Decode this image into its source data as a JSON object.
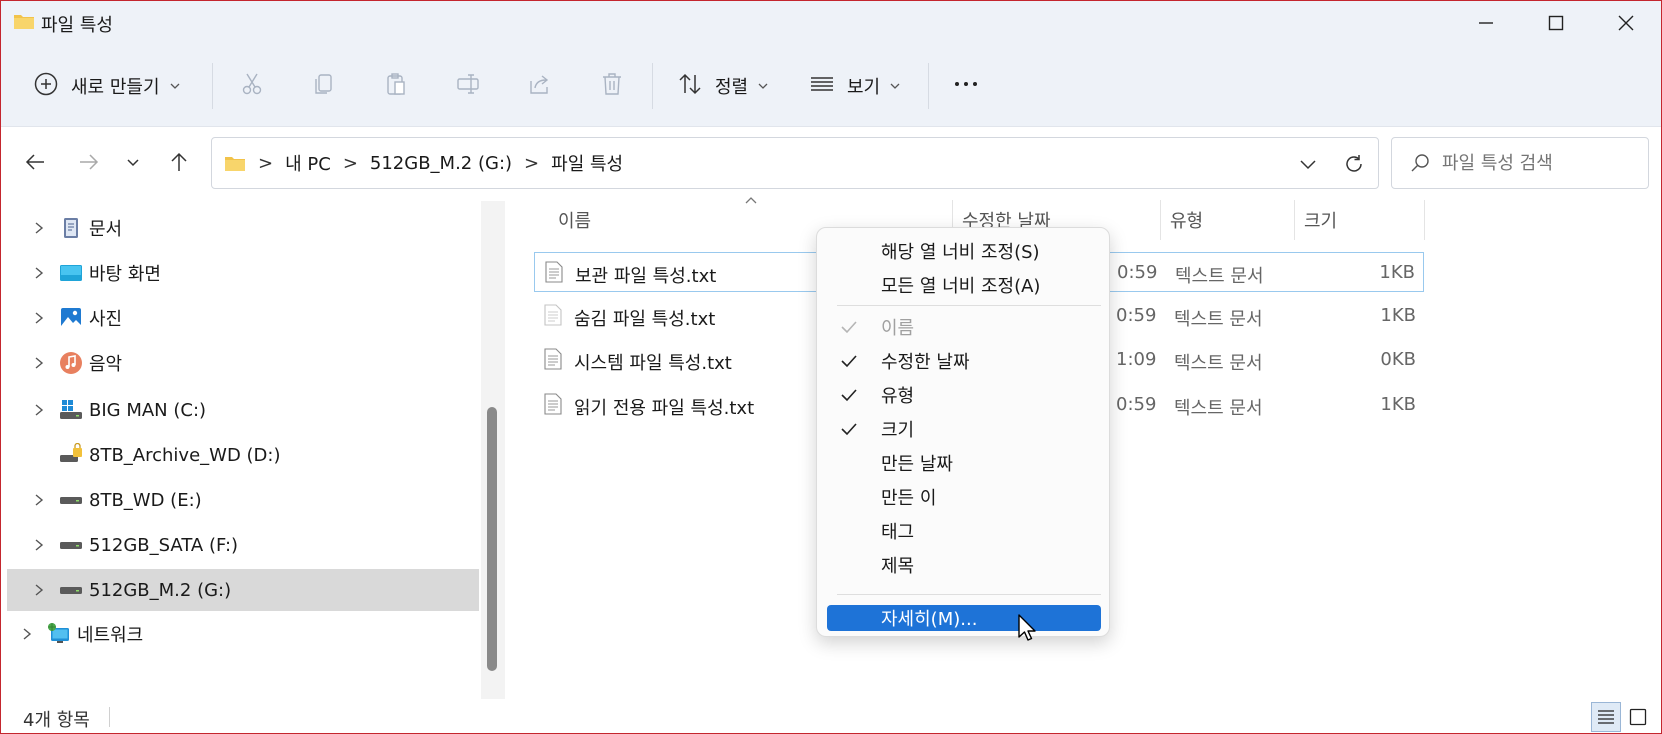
{
  "window": {
    "title": "파일 특성"
  },
  "toolbar": {
    "new_label": "새로 만들기",
    "sort_label": "정렬",
    "view_label": "보기"
  },
  "address": {
    "crumbs": [
      "내 PC",
      "512GB_M.2 (G:)",
      "파일 특성"
    ]
  },
  "search": {
    "placeholder": "파일 특성 검색"
  },
  "sidebar": {
    "items": [
      {
        "label": "문서",
        "icon": "documents-icon"
      },
      {
        "label": "바탕 화면",
        "icon": "desktop-icon"
      },
      {
        "label": "사진",
        "icon": "pictures-icon"
      },
      {
        "label": "음악",
        "icon": "music-icon"
      },
      {
        "label": "BIG MAN (C:)",
        "icon": "windows-drive-icon"
      },
      {
        "label": "8TB_Archive_WD (D:)",
        "icon": "locked-drive-icon"
      },
      {
        "label": "8TB_WD (E:)",
        "icon": "drive-icon"
      },
      {
        "label": "512GB_SATA (F:)",
        "icon": "drive-icon"
      },
      {
        "label": "512GB_M.2 (G:)",
        "icon": "drive-icon"
      },
      {
        "label": "네트워크",
        "icon": "network-icon"
      }
    ]
  },
  "columns": {
    "name": "이름",
    "date": "수정한 날짜",
    "type": "유형",
    "size": "크기"
  },
  "files": [
    {
      "name": "보관 파일 특성.txt",
      "date": "0:59",
      "type": "텍스트 문서",
      "size": "1KB"
    },
    {
      "name": "숨김 파일 특성.txt",
      "date": "0:59",
      "type": "텍스트 문서",
      "size": "1KB"
    },
    {
      "name": "시스템 파일 특성.txt",
      "date": "1:09",
      "type": "텍스트 문서",
      "size": "0KB"
    },
    {
      "name": "읽기 전용 파일 특성.txt",
      "date": "0:59",
      "type": "텍스트 문서",
      "size": "1KB"
    }
  ],
  "context_menu": {
    "fit_column": "해당 열 너비 조정(S)",
    "fit_all": "모든 열 너비 조정(A)",
    "items": [
      {
        "label": "이름",
        "checked": true,
        "disabled": true
      },
      {
        "label": "수정한 날짜",
        "checked": true
      },
      {
        "label": "유형",
        "checked": true
      },
      {
        "label": "크기",
        "checked": true
      },
      {
        "label": "만든 날짜",
        "checked": false
      },
      {
        "label": "만든 이",
        "checked": false
      },
      {
        "label": "태그",
        "checked": false
      },
      {
        "label": "제목",
        "checked": false
      }
    ],
    "more": "자세히(M)..."
  },
  "status": {
    "count": "4개 항목"
  },
  "colors": {
    "accent": "#1e73d7",
    "border": "#c4262e",
    "chrome": "#eef2f8"
  }
}
